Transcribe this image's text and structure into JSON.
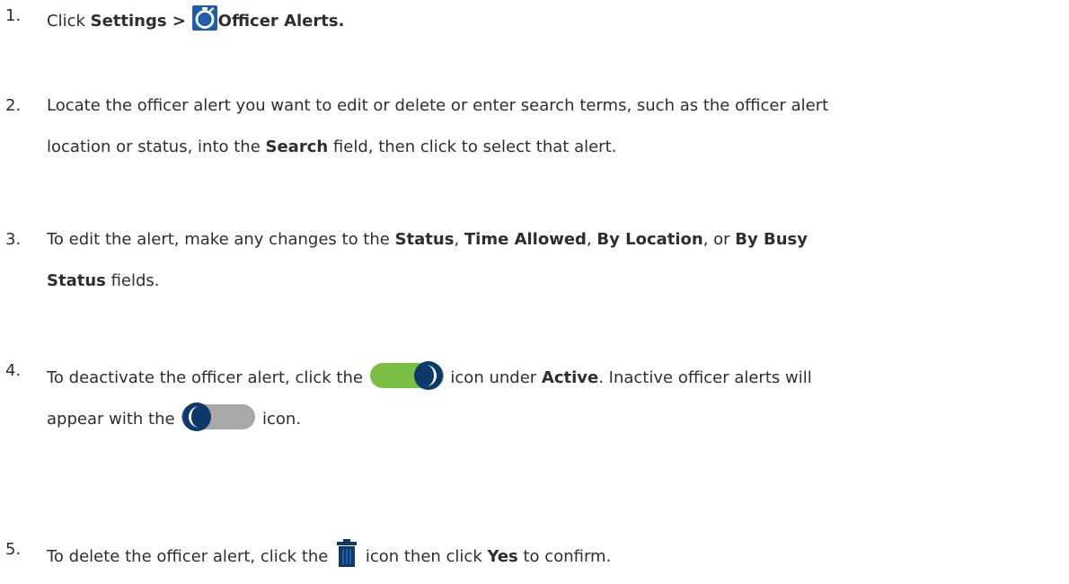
{
  "steps": [
    {
      "num": "1.",
      "lines": [
        {
          "t1": "Click ",
          "b1": "Settings >",
          "b2": "Officer Alerts."
        }
      ]
    },
    {
      "num": "2.",
      "line1": "Locate the officer alert you want to edit or delete or enter search terms, such as the officer alert",
      "line2_pre": "location or status, into the ",
      "line2_b": "Search",
      "line2_post": " field, then click to select that alert."
    },
    {
      "num": "3.",
      "line1_pre": "To edit the alert, make any changes to the ",
      "b_status": "Status",
      "sep1": ", ",
      "b_time": "Time Allowed",
      "sep2": ", ",
      "b_loc": "By Location",
      "sep3": ", or ",
      "b_busy": "By Busy",
      "line2_b": "Status",
      "line2_post": " fields."
    },
    {
      "num": "4.",
      "line1_pre": "To deactivate the officer alert, click the ",
      "line1_mid": " icon under ",
      "line1_b": "Active",
      "line1_post": ". Inactive officer alerts will",
      "line2_pre": "appear with the ",
      "line2_post": " icon."
    },
    {
      "num": "5.",
      "line1_pre": "To delete the officer alert, click the ",
      "line1_mid": " icon then click ",
      "line1_b": "Yes",
      "line1_post": " to confirm."
    }
  ],
  "icons": {
    "stopwatch": "stopwatch-icon",
    "toggle_on": "toggle-on-icon",
    "toggle_off": "toggle-off-icon",
    "trash": "trash-icon"
  },
  "colors": {
    "text": "#2e2e2e",
    "icon_navy": "#0e3a6b",
    "icon_blue": "#1f5fa8",
    "toggle_green": "#7bc043",
    "toggle_gray": "#a8a8a8"
  }
}
